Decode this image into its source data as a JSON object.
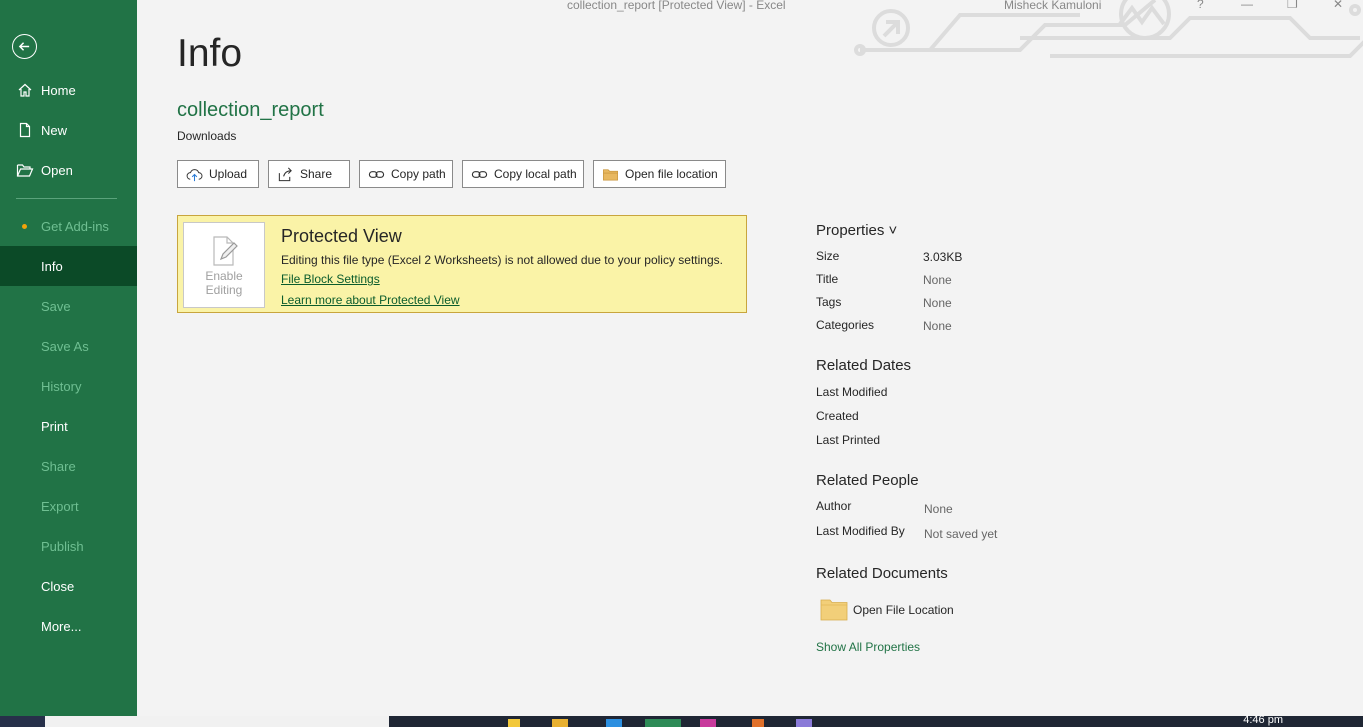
{
  "window": {
    "title": "collection_report  [Protected View]  -  Excel",
    "user": "Misheck Kamuloni",
    "help": "?",
    "minimize": "—",
    "restore": "❐",
    "close": "✕"
  },
  "sidebar": {
    "items": [
      {
        "label": "Home",
        "icon": "home-icon",
        "state": "normal"
      },
      {
        "label": "New",
        "icon": "new-doc-icon",
        "state": "normal"
      },
      {
        "label": "Open",
        "icon": "folder-open-icon",
        "state": "normal"
      },
      {
        "label": "Get Add-ins",
        "state": "disabled"
      },
      {
        "label": "Info",
        "state": "selected"
      },
      {
        "label": "Save",
        "state": "disabled"
      },
      {
        "label": "Save As",
        "state": "disabled"
      },
      {
        "label": "History",
        "state": "disabled"
      },
      {
        "label": "Print",
        "state": "normal"
      },
      {
        "label": "Share",
        "state": "disabled"
      },
      {
        "label": "Export",
        "state": "disabled"
      },
      {
        "label": "Publish",
        "state": "disabled"
      },
      {
        "label": "Close",
        "state": "normal"
      },
      {
        "label": "More...",
        "state": "normal"
      }
    ]
  },
  "main": {
    "title": "Info",
    "doc_name": "collection_report",
    "doc_location": "Downloads",
    "actions": [
      {
        "label": "Upload",
        "icon": "cloud-upload-icon"
      },
      {
        "label": "Share",
        "icon": "share-icon"
      },
      {
        "label": "Copy path",
        "icon": "link-icon"
      },
      {
        "label": "Copy local path",
        "icon": "link-icon"
      },
      {
        "label": "Open file location",
        "icon": "folder-icon"
      }
    ],
    "protected_view": {
      "button_label_1": "Enable",
      "button_label_2": "Editing",
      "title": "Protected View",
      "description": "Editing this file type (Excel 2 Worksheets) is not allowed due to your policy settings.",
      "link_1": "File Block Settings",
      "link_2": "Learn more about Protected View"
    }
  },
  "properties": {
    "header": "Properties ˅",
    "size_label": "Size",
    "size_value": "3.03KB",
    "title_label": "Title",
    "title_value": "None",
    "tags_label": "Tags",
    "tags_value": "None",
    "categories_label": "Categories",
    "categories_value": "None",
    "dates_header": "Related Dates",
    "last_modified": "Last Modified",
    "created": "Created",
    "last_printed": "Last Printed",
    "people_header": "Related People",
    "author_label": "Author",
    "author_value": "None",
    "last_modified_by_label": "Last Modified By",
    "last_modified_by_value": "Not saved yet",
    "documents_header": "Related Documents",
    "open_file_location": "Open File Location",
    "show_all": "Show All Properties"
  },
  "taskbar": {
    "time": "4:46 pm"
  },
  "colors": {
    "excel_green": "#217346",
    "selected_nav": "#0b4a27",
    "protected_bg": "#faf3a7"
  }
}
